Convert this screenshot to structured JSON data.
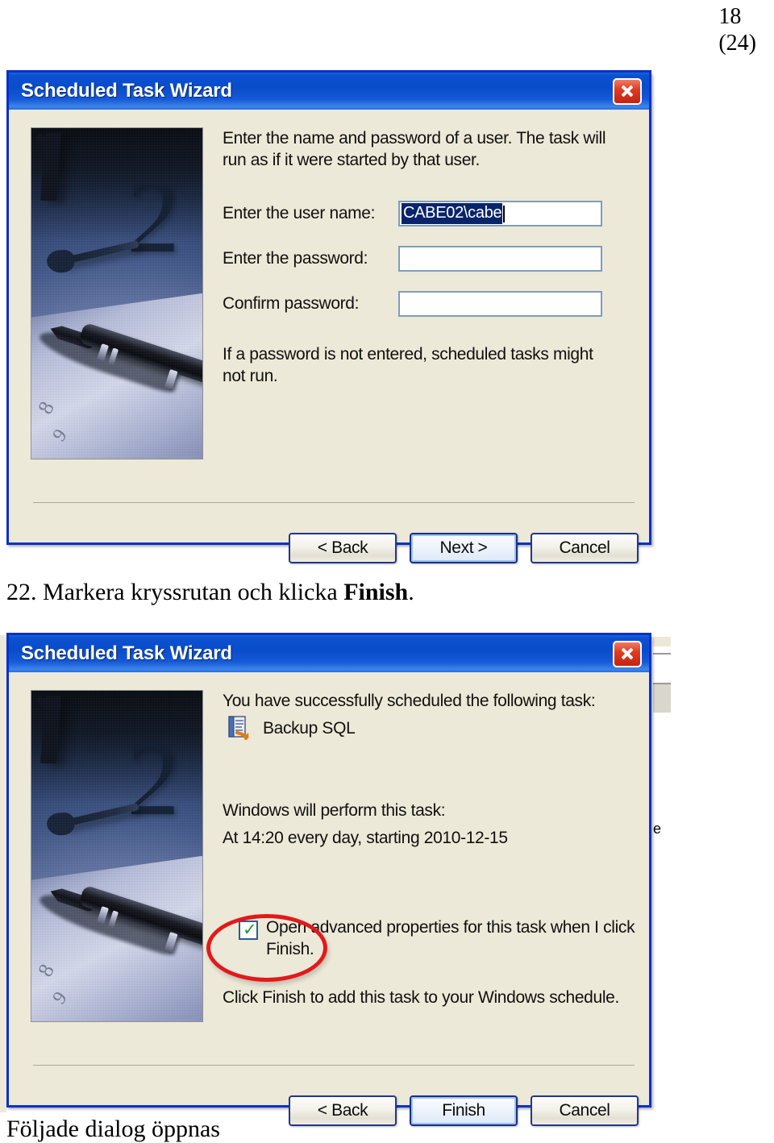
{
  "page": {
    "number": "18",
    "total": "(24)"
  },
  "dialog1": {
    "title": "Scheduled Task Wizard",
    "close_icon": "close-icon",
    "intro_line1": "Enter the name and password of a user.  The task will",
    "intro_line2": "run as if it were started by that user.",
    "fields": [
      {
        "label": "Enter the user name:",
        "value": "CABE02\\cabe",
        "selected": true
      },
      {
        "label": "Enter the password:",
        "value": "",
        "selected": false
      },
      {
        "label": "Confirm password:",
        "value": "",
        "selected": false
      }
    ],
    "note_line1": "If a password is not entered, scheduled tasks might",
    "note_line2": "not run.",
    "buttons": [
      {
        "label": "< Back",
        "default": false
      },
      {
        "label": "Next >",
        "default": true
      },
      {
        "label": "Cancel",
        "default": false
      }
    ]
  },
  "instruction1": {
    "prefix": "22. Markera kryssrutan och klicka ",
    "bold": "Finish",
    "suffix": "."
  },
  "dialog2": {
    "title": "Scheduled Task Wizard",
    "close_icon": "close-icon",
    "success_text": "You have successfully scheduled the following task:",
    "task_icon": "scheduled-task-icon",
    "task_name": "Backup SQL",
    "perform_label": "Windows will perform this task:",
    "schedule_text": "At 14:20 every day, starting 2010-12-15",
    "checkbox": {
      "checked": true,
      "label_line1": "Open advanced properties for this task when I click",
      "label_line2": "Finish."
    },
    "finish_hint": "Click Finish to add this task to your Windows schedule.",
    "buttons": [
      {
        "label": "< Back",
        "default": false
      },
      {
        "label": "Finish",
        "default": true
      },
      {
        "label": "Cancel",
        "default": false
      }
    ]
  },
  "instruction2": {
    "text": "Följade dialog öppnas"
  },
  "colors": {
    "titlebar_blue": "#0a4cca",
    "dialog_face": "#ece9d8",
    "selection_blue": "#0a246a",
    "close_red": "#df3a22",
    "annotation_red": "#e2191b",
    "check_green": "#1e9b28"
  }
}
